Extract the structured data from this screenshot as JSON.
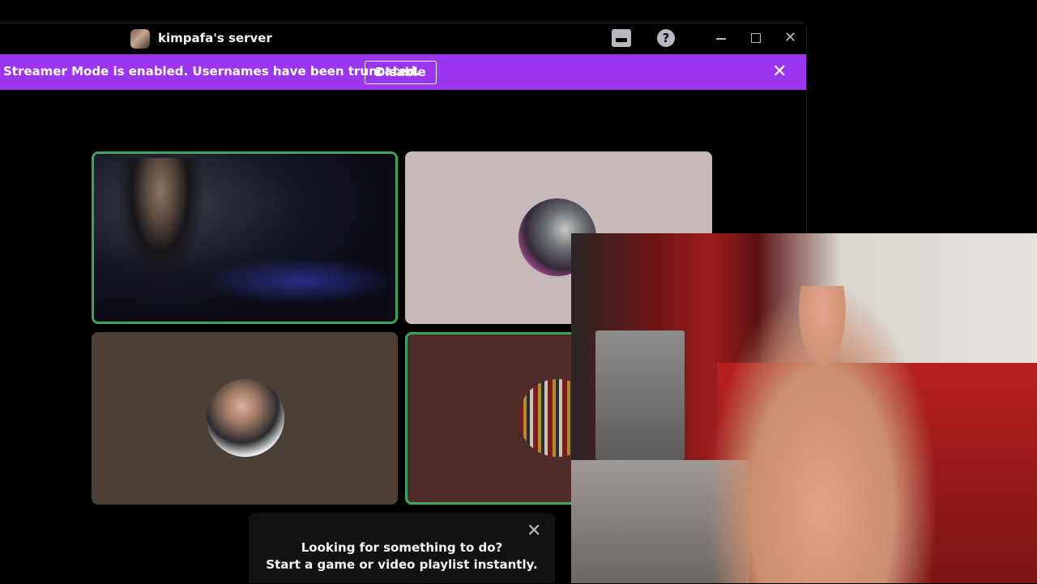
{
  "titlebar": {
    "server_name": "kimpafa's server",
    "icons": [
      "server-icon",
      "inbox-icon",
      "help-icon",
      "minimize-icon",
      "maximize-icon",
      "close-icon"
    ]
  },
  "banner": {
    "message": "Streamer Mode is enabled. Usernames have been truncated.",
    "button_label": "Disable",
    "close_glyph": "✕",
    "color": "#9b35f0"
  },
  "video_grid": {
    "tiles": [
      {
        "type": "video",
        "speaking": true
      },
      {
        "type": "avatar",
        "speaking": false,
        "background": "#c6b9b9"
      },
      {
        "type": "avatar",
        "speaking": false,
        "background": "#4c3f35"
      },
      {
        "type": "avatar",
        "speaking": true,
        "background": "#4f2c2a"
      }
    ],
    "speaking_color": "#3ba55d"
  },
  "activity_prompt": {
    "line1": "Looking for something to do?",
    "line2": "Start a game or video playlist instantly.",
    "close_glyph": "✕"
  },
  "help_glyph": "?",
  "window_close_glyph": "✕"
}
